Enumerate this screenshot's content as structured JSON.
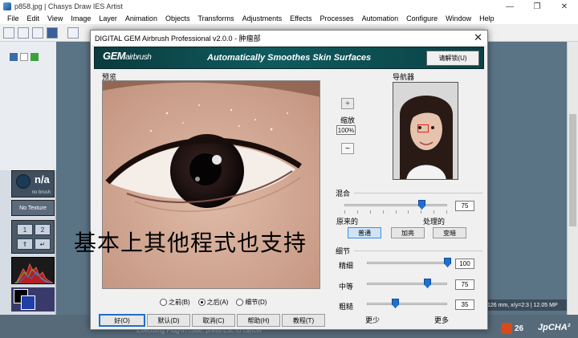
{
  "host": {
    "title": "p858.jpg | Chasys Draw IES Artist",
    "menu": [
      "File",
      "Edit",
      "View",
      "Image",
      "Layer",
      "Animation",
      "Objects",
      "Transforms",
      "Adjustments",
      "Effects",
      "Processes",
      "Automation",
      "Configure",
      "Window",
      "Help"
    ],
    "brush_label": "n/a",
    "brush_sub": "no brush",
    "texture_label": "No Texture",
    "grid_buttons": [
      "1",
      "2",
      "⇑",
      "↵"
    ],
    "status_right": "126 mm, x/y=2:3 | 12.05 MP",
    "status_bottom": "Executing Plug-in code, press Esc to cancel",
    "badge_count": "26",
    "watermark": "JpCHA²"
  },
  "dialog": {
    "title": "DIGITAL GEM Airbrush Professional v2.0.0 - 肿瘤部",
    "banner": {
      "logo_main": "GEM",
      "logo_sub": "airbrush",
      "slogan": "Automatically Smoothes Skin Surfaces",
      "register_label": "请解锁(U)"
    },
    "preview_label": "预览",
    "navigator_label": "导航器",
    "zoom": {
      "label": "缩放",
      "value": "100%",
      "plus": "+",
      "minus": "−"
    },
    "mix": {
      "label": "混合",
      "value": "75",
      "value_frac": 0.75,
      "left_label": "原来的",
      "right_label": "处理的",
      "modes": [
        "普通",
        "加亮",
        "变暗"
      ],
      "selected_mode": 0
    },
    "detail": {
      "label": "细节",
      "sliders": [
        {
          "label": "精细",
          "value": "100",
          "frac": 1.0
        },
        {
          "label": "中等",
          "value": "75",
          "frac": 0.75
        },
        {
          "label": "粗糙",
          "value": "35",
          "frac": 0.35
        }
      ],
      "less": "更少",
      "more": "更多"
    },
    "view_options": [
      {
        "label": "之前(B)",
        "checked": false
      },
      {
        "label": "之后(A)",
        "checked": true
      },
      {
        "label": "细节(D)",
        "checked": false
      }
    ],
    "buttons": [
      "好(O)",
      "默认(D)",
      "取消(C)",
      "帮助(H)",
      "教程(T)"
    ]
  },
  "overlay": "基本上其他程式也支持",
  "colors": {
    "banner": "#0f5a5e",
    "accent": "#1e6fd0",
    "skin": "#cfa995",
    "nav_marker": "#e02020"
  }
}
